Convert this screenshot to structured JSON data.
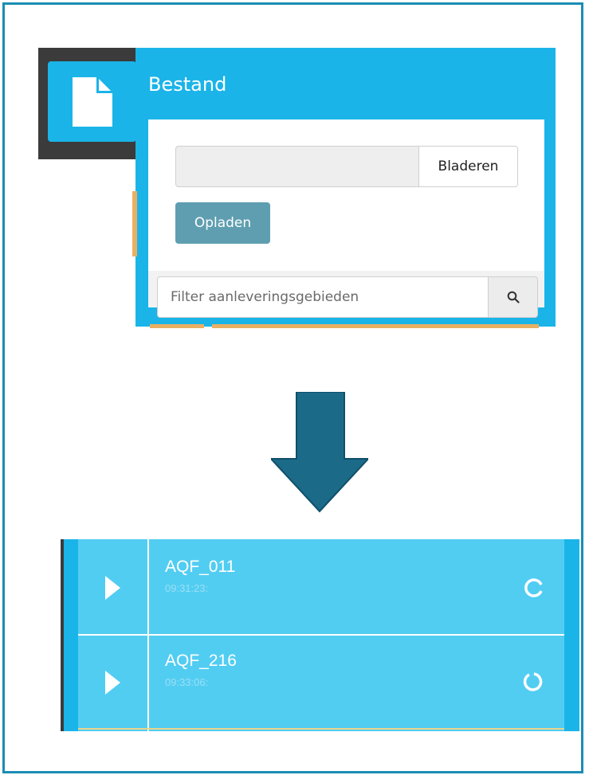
{
  "upload_panel": {
    "title": "Bestand",
    "browse_label": "Bladeren",
    "upload_label": "Opladen",
    "filter_placeholder": "Filter aanleveringsgebieden",
    "icons": {
      "document": "document-icon",
      "search": "search-icon"
    }
  },
  "transition": {
    "icon": "arrow-down-icon"
  },
  "items": [
    {
      "name": "AQF_011",
      "time": "09:31:23:",
      "status_icon": "loading-icon"
    },
    {
      "name": "AQF_216",
      "time": "09:33:06:",
      "status_icon": "loading-icon"
    }
  ],
  "colors": {
    "panel_blue": "#1ab4e8",
    "list_blue": "#52cdf2",
    "upload_button": "#5f9eb0",
    "arrow": "#1b6a88",
    "accent_orange": "#e9b063",
    "frame_border": "#1b8db5"
  }
}
